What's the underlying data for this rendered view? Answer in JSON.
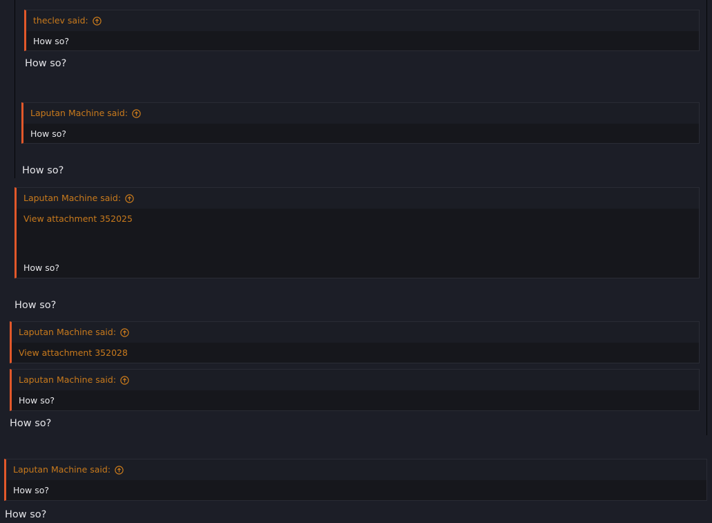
{
  "thread": {
    "quote1": {
      "author": "theclev said:",
      "body": "How so?"
    },
    "reply1": "How so?",
    "quote2": {
      "author": "Laputan Machine said:",
      "body": "How so?"
    },
    "reply2": "How so?",
    "quote3": {
      "author": "Laputan Machine said:",
      "attachment": "View attachment 352025",
      "body": "How so?"
    },
    "reply3": "How so?",
    "quote4": {
      "author": "Laputan Machine said:",
      "attachment": "View attachment 352028"
    },
    "quote5": {
      "author": "Laputan Machine said:",
      "body": "How so?"
    },
    "reply4": "How so?",
    "quote6": {
      "author": "Laputan Machine said:",
      "body": "How so?"
    },
    "reply5": "How so?"
  },
  "icons": {
    "jump": "arrow-up-circle-icon"
  },
  "colors": {
    "background": "#1c1e27",
    "quote_bg": "#16171c",
    "quote_header_bg": "#1b1d25",
    "accent_border": "#e2582a",
    "author_text": "#c97a1c",
    "text": "#e4e4e8"
  }
}
